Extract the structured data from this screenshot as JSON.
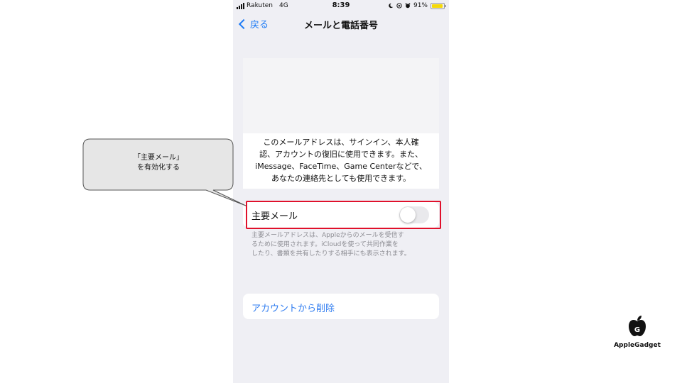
{
  "status_bar": {
    "carrier": "Rakuten",
    "network": "4G",
    "time": "8:39",
    "battery_percent": "91%",
    "battery_level": 0.91,
    "battery_color": "#f5d90a",
    "icons": [
      "signal-icon",
      "moon-icon",
      "orientation-lock-icon",
      "alarm-icon",
      "battery-icon"
    ]
  },
  "nav": {
    "back_label": "戻る",
    "title": "メールと電話番号"
  },
  "description": {
    "lines": [
      "このメールアドレスは、サインイン、本人確",
      "認、アカウントの復旧に使用できます。また、",
      "iMessage、FaceTime、Game Centerなどで、",
      "あなたの連絡先としても使用できます。"
    ]
  },
  "primary_email": {
    "label": "主要メール",
    "toggle_on": false
  },
  "footnote": {
    "lines": [
      "主要メールアドレスは、Appleからのメールを受信す",
      "るために使用されます。iCloudを使って共同作業を",
      "したり、書類を共有したりする相手にも表示されます。"
    ]
  },
  "delete_account": {
    "label": "アカウントから削除",
    "color": "#2f7cf0"
  },
  "callout": {
    "line1": "「主要メール」",
    "line2": "を有効化する",
    "highlight_color": "#e0102b"
  },
  "logo": {
    "text": "AppleGadget"
  }
}
